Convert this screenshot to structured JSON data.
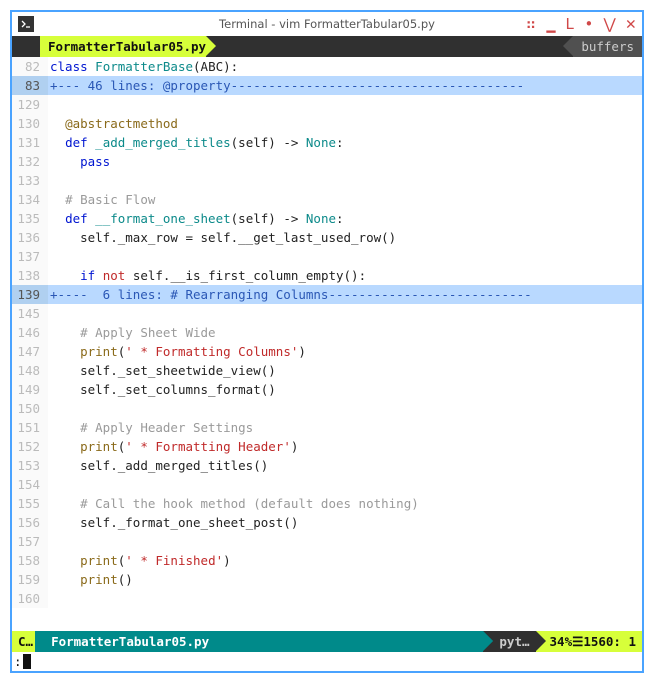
{
  "window": {
    "title": "Terminal - vim FormatterTabular05.py"
  },
  "tabs": {
    "active": "FormatterTabular05.py",
    "right": "buffers"
  },
  "folds": {
    "f1_num": "83",
    "f1_text": "+--- 46 lines: @property---------------------------------------",
    "f2_num": "139",
    "f2_text": "+----  6 lines: # Rearranging Columns---------------------------"
  },
  "lines": {
    "l82": "82",
    "c82_kw": "class",
    "c82_name": "FormatterBase",
    "c82_paren": "(ABC):",
    "l129": "129",
    "l130": "130",
    "c130_dec": "@abstractmethod",
    "l131": "131",
    "c131_def": "def",
    "c131_name": "_add_merged_titles",
    "c131_sig": "(self) -> ",
    "c131_ret": "None",
    "c131_colon": ":",
    "l132": "132",
    "c132": "pass",
    "l133": "133",
    "l134": "134",
    "c134": "# Basic Flow",
    "l135": "135",
    "c135_def": "def",
    "c135_name": "__format_one_sheet",
    "c135_sig": "(self) -> ",
    "c135_ret": "None",
    "c135_colon": ":",
    "l136": "136",
    "c136": "self._max_row = self.__get_last_used_row()",
    "l137": "137",
    "l138": "138",
    "c138_if": "if",
    "c138_not": " not ",
    "c138_rest": "self.__is_first_column_empty():",
    "l145": "145",
    "l146": "146",
    "c146": "# Apply Sheet Wide",
    "l147": "147",
    "c147_fn": "print",
    "c147_open": "(",
    "c147_str": "' * Formatting Columns'",
    "c147_close": ")",
    "l148": "148",
    "c148": "self._set_sheetwide_view()",
    "l149": "149",
    "c149": "self._set_columns_format()",
    "l150": "150",
    "l151": "151",
    "c151": "# Apply Header Settings",
    "l152": "152",
    "c152_fn": "print",
    "c152_open": "(",
    "c152_str": "' * Formatting Header'",
    "c152_close": ")",
    "l153": "153",
    "c153": "self._add_merged_titles()",
    "l154": "154",
    "l155": "155",
    "c155": "# Call the hook method (default does nothing)",
    "l156": "156",
    "c156": "self._format_one_sheet_post()",
    "l157": "157",
    "l158": "158",
    "c158_fn": "print",
    "c158_open": "(",
    "c158_str": "' * Finished'",
    "c158_close": ")",
    "l159": "159",
    "c159_fn": "print",
    "c159_rest": "()",
    "l160": "160"
  },
  "status": {
    "mode": "C…",
    "fname": "FormatterTabular05.py",
    "filetype": "pyt…",
    "percent": "34%",
    "sep": " ☰ ",
    "pos": "1560: 1"
  },
  "cmd": {
    "prompt": ":"
  }
}
